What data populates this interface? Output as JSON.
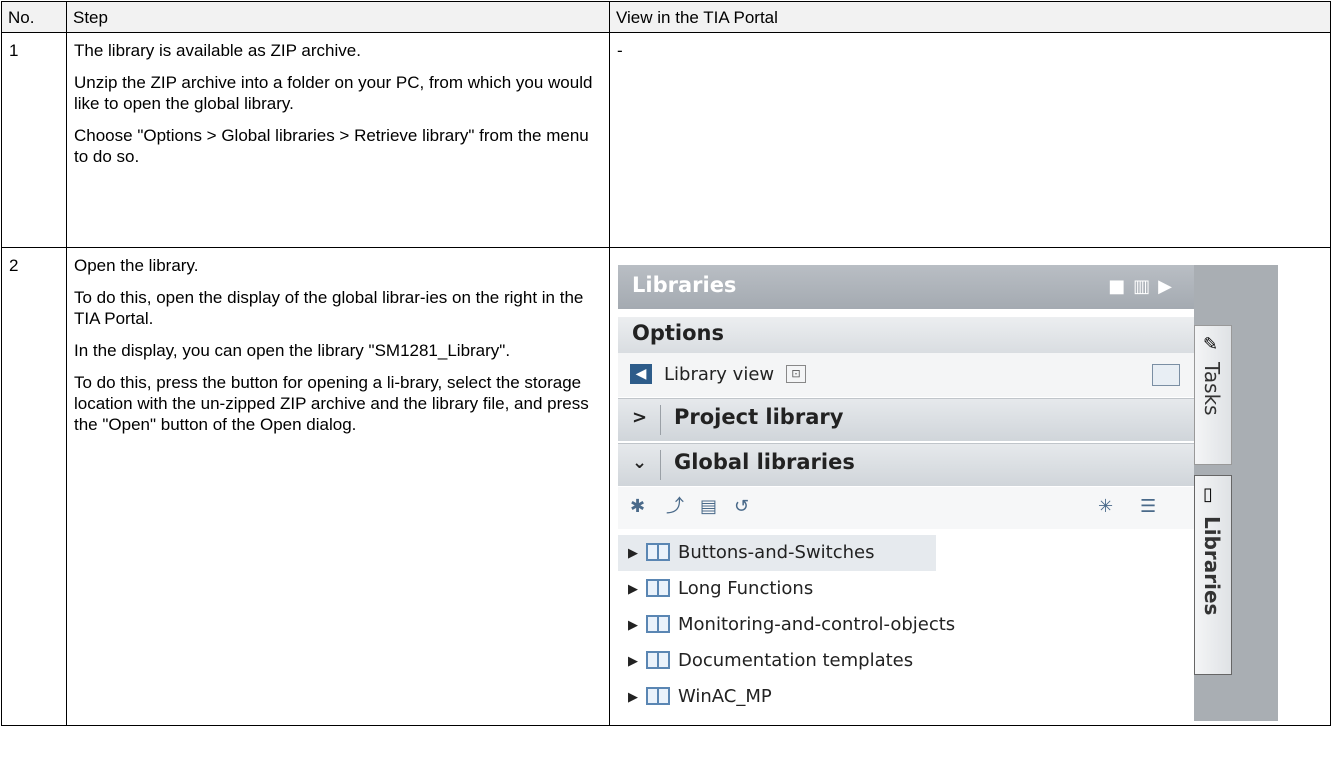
{
  "table": {
    "headers": {
      "no": "No.",
      "step": "Step",
      "view": "View in the TIA Portal"
    },
    "rows": [
      {
        "no": "1",
        "step": [
          "The library is available as ZIP archive.",
          "Unzip the ZIP archive into a folder on your PC, from which you would like to open the global library.",
          "Choose \"Options > Global libraries > Retrieve library\" from the menu to do so."
        ],
        "view": "-"
      },
      {
        "no": "2",
        "step": [
          "Open the library.",
          "To do this, open the display of the global librar-ies on the right in the TIA Portal.",
          "In the display, you can open the library \"SM1281_Library\".",
          "To do this, press the button for opening a li-brary, select the storage location with the un-zipped ZIP archive and the library file, and press the \"Open\" button of the Open dialog."
        ]
      }
    ]
  },
  "tia_panel": {
    "title": "Libraries",
    "options_label": "Options",
    "library_view_label": "Library view",
    "project_library_label": "Project library",
    "global_libraries_label": "Global libraries",
    "libraries": [
      {
        "name": "Buttons-and-Switches",
        "selected": true
      },
      {
        "name": "Long Functions",
        "selected": false
      },
      {
        "name": "Monitoring-and-control-objects",
        "selected": false
      },
      {
        "name": "Documentation templates",
        "selected": false
      },
      {
        "name": "WinAC_MP",
        "selected": false
      }
    ],
    "side_tabs": [
      "Tasks",
      "Libraries"
    ]
  }
}
